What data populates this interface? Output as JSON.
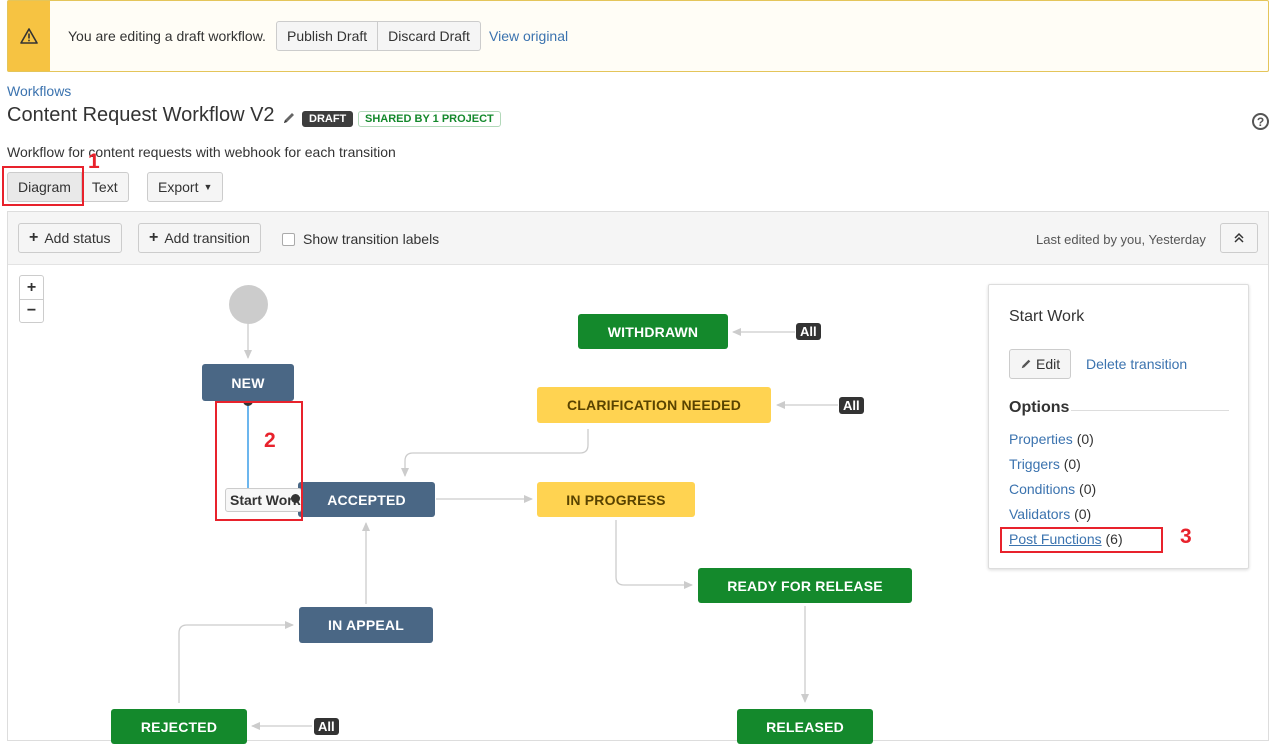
{
  "banner": {
    "message": "You are editing a draft workflow.",
    "publish_label": "Publish Draft",
    "discard_label": "Discard Draft",
    "view_original_label": "View original"
  },
  "header": {
    "breadcrumb": "Workflows",
    "title": "Content Request Workflow V2",
    "badge_draft": "DRAFT",
    "badge_shared": "SHARED BY 1 PROJECT",
    "help": "?",
    "description": "Workflow for content requests with webhook for each transition"
  },
  "view_tabs": {
    "diagram": "Diagram",
    "text": "Text",
    "export": "Export"
  },
  "toolbar": {
    "add_status": "Add status",
    "add_transition": "Add transition",
    "show_labels": "Show transition labels",
    "last_edited": "Last edited by you, Yesterday"
  },
  "zoom": {
    "in": "+",
    "out": "−"
  },
  "nodes": {
    "new": "NEW",
    "accepted": "ACCEPTED",
    "in_progress": "IN PROGRESS",
    "clarification": "CLARIFICATION NEEDED",
    "withdrawn": "WITHDRAWN",
    "ready_for_release": "READY FOR RELEASE",
    "released": "RELEASED",
    "in_appeal": "IN APPEAL",
    "rejected": "REJECTED"
  },
  "all_tag": "All",
  "transition_label": "Start Work",
  "panel": {
    "title": "Start Work",
    "edit": "Edit",
    "delete": "Delete transition",
    "options_heading": "Options",
    "options": [
      {
        "name": "Properties",
        "count": "(0)"
      },
      {
        "name": "Triggers",
        "count": "(0)"
      },
      {
        "name": "Conditions",
        "count": "(0)"
      },
      {
        "name": "Validators",
        "count": "(0)"
      },
      {
        "name": "Post Functions",
        "count": "(6)"
      }
    ]
  },
  "annotations": {
    "one": "1",
    "two": "2",
    "three": "3"
  },
  "colors": {
    "status_todo": "#4a6785",
    "status_done": "#14892c",
    "status_inprogress": "#ffd351",
    "annotation_red": "#e8222c",
    "link": "#3b73af"
  }
}
